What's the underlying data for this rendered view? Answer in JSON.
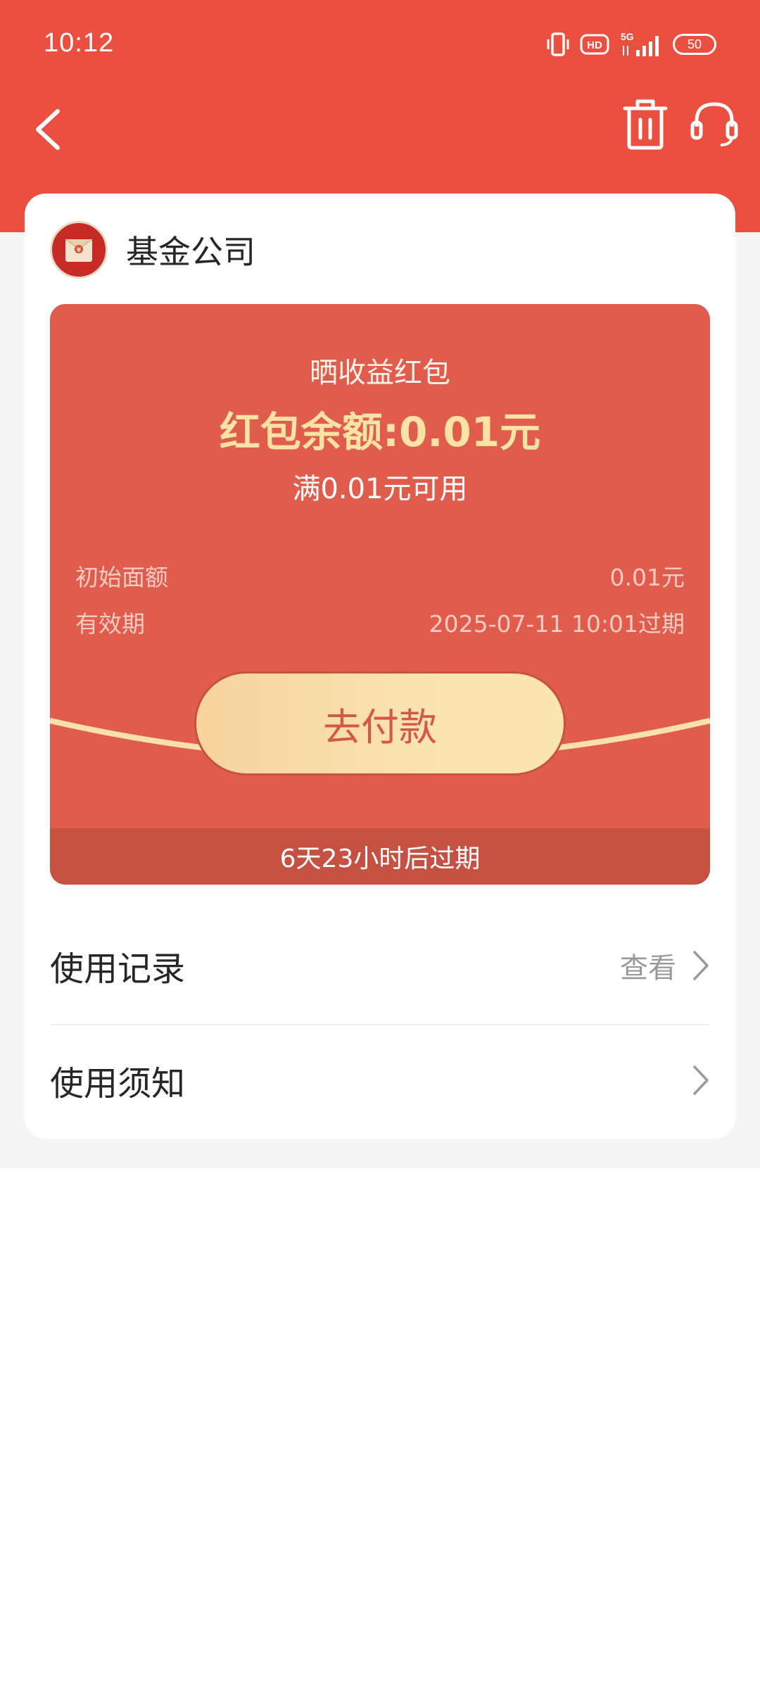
{
  "status_bar": {
    "time": "10:12",
    "network": "5G",
    "hd_label": "HD",
    "battery": "50"
  },
  "nav": {
    "back_icon": "chevron-left-icon",
    "trash_icon": "trash-icon",
    "service_icon": "headset-icon"
  },
  "colors": {
    "header_red": "#EA4F3F",
    "coupon_red": "#E05D4D",
    "balance_gold": "#FCE3A4",
    "button_gold": "#F8DDA6",
    "expire_bar": "#C55143"
  },
  "company": {
    "name": "基金公司",
    "logo_icon": "red-envelope-icon"
  },
  "coupon": {
    "type": "晒收益红包",
    "balance": "红包余额:0.01元",
    "condition": "满0.01元可用",
    "initial_label": "初始面额",
    "initial_value": "0.01元",
    "validity_label": "有效期",
    "validity_value": "2025-07-11 10:01过期",
    "pay_button": "去付款",
    "expire_notice": "6天23小时后过期"
  },
  "menu": {
    "records_label": "使用记录",
    "records_action": "查看",
    "notice_label": "使用须知"
  }
}
